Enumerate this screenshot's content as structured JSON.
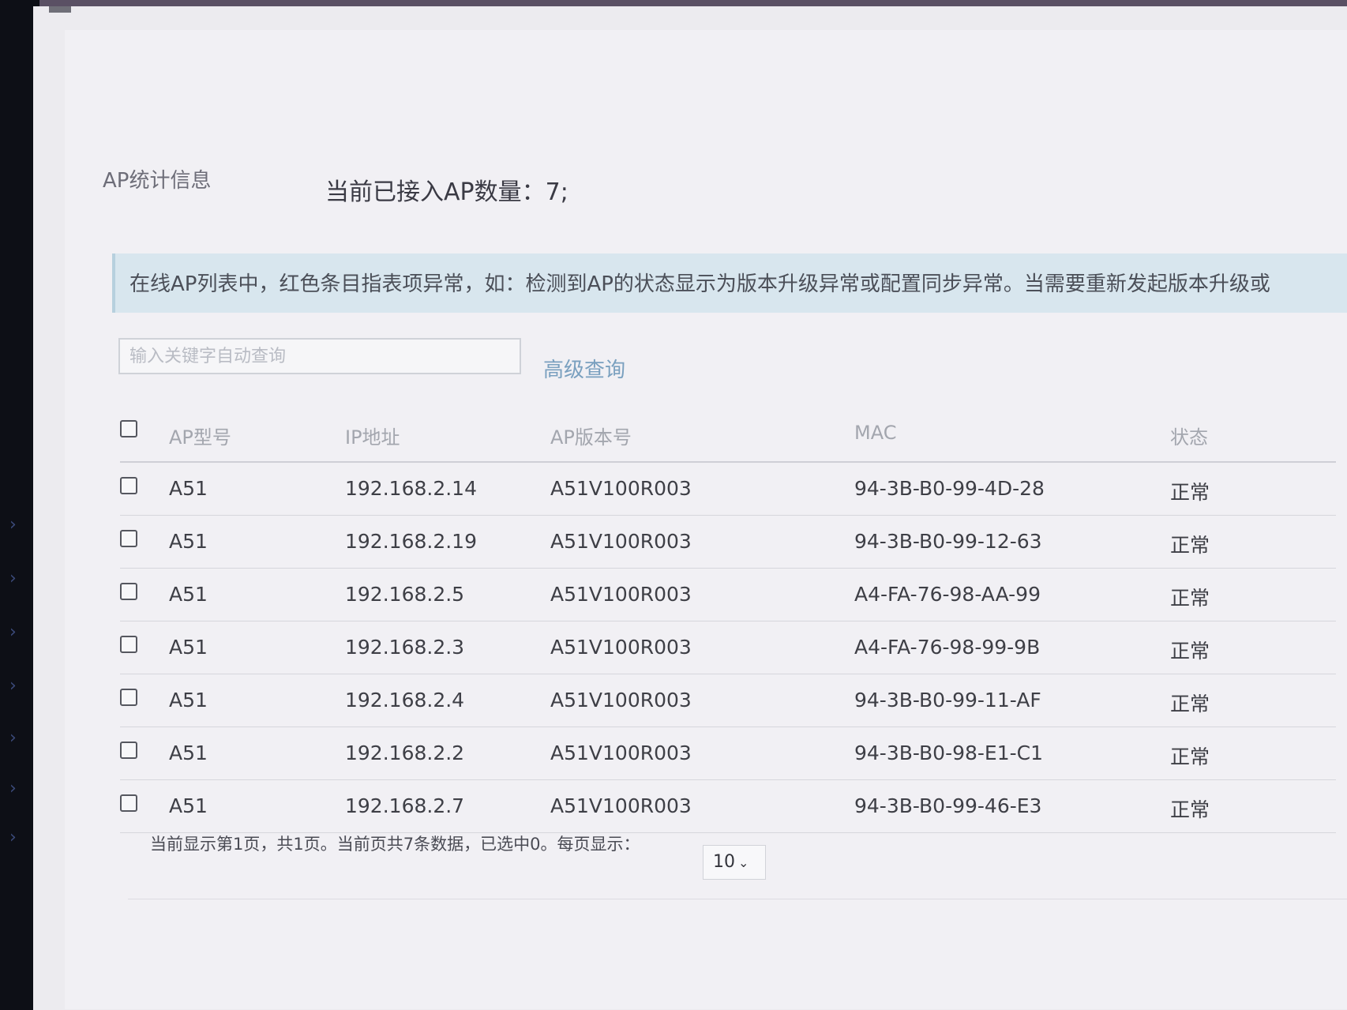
{
  "stats": {
    "label": "AP统计信息",
    "count_text": "当前已接入AP数量：7;"
  },
  "notice": {
    "text": "在线AP列表中，红色条目指表项异常，如：检测到AP的状态显示为版本升级异常或配置同步异常。当需要重新发起版本升级或"
  },
  "search": {
    "placeholder": "输入关键字自动查询",
    "advanced_label": "高级查询"
  },
  "table": {
    "columns": [
      "AP型号",
      "IP地址",
      "AP版本号",
      "MAC",
      "状态"
    ],
    "rows": [
      {
        "model": "A51",
        "ip": "192.168.2.14",
        "version": "A51V100R003",
        "mac": "94-3B-B0-99-4D-28",
        "status": "正常"
      },
      {
        "model": "A51",
        "ip": "192.168.2.19",
        "version": "A51V100R003",
        "mac": "94-3B-B0-99-12-63",
        "status": "正常"
      },
      {
        "model": "A51",
        "ip": "192.168.2.5",
        "version": "A51V100R003",
        "mac": "A4-FA-76-98-AA-99",
        "status": "正常"
      },
      {
        "model": "A51",
        "ip": "192.168.2.3",
        "version": "A51V100R003",
        "mac": "A4-FA-76-98-99-9B",
        "status": "正常"
      },
      {
        "model": "A51",
        "ip": "192.168.2.4",
        "version": "A51V100R003",
        "mac": "94-3B-B0-99-11-AF",
        "status": "正常"
      },
      {
        "model": "A51",
        "ip": "192.168.2.2",
        "version": "A51V100R003",
        "mac": "94-3B-B0-98-E1-C1",
        "status": "正常"
      },
      {
        "model": "A51",
        "ip": "192.168.2.7",
        "version": "A51V100R003",
        "mac": "94-3B-B0-99-46-E3",
        "status": "正常"
      }
    ]
  },
  "footer": {
    "summary": "当前显示第1页，共1页。当前页共7条数据，已选中0。每页显示：",
    "page_size": "10"
  },
  "icons": {
    "rail_arrow": "chevron-right-icon",
    "dropdown": "chevron-down-icon"
  }
}
